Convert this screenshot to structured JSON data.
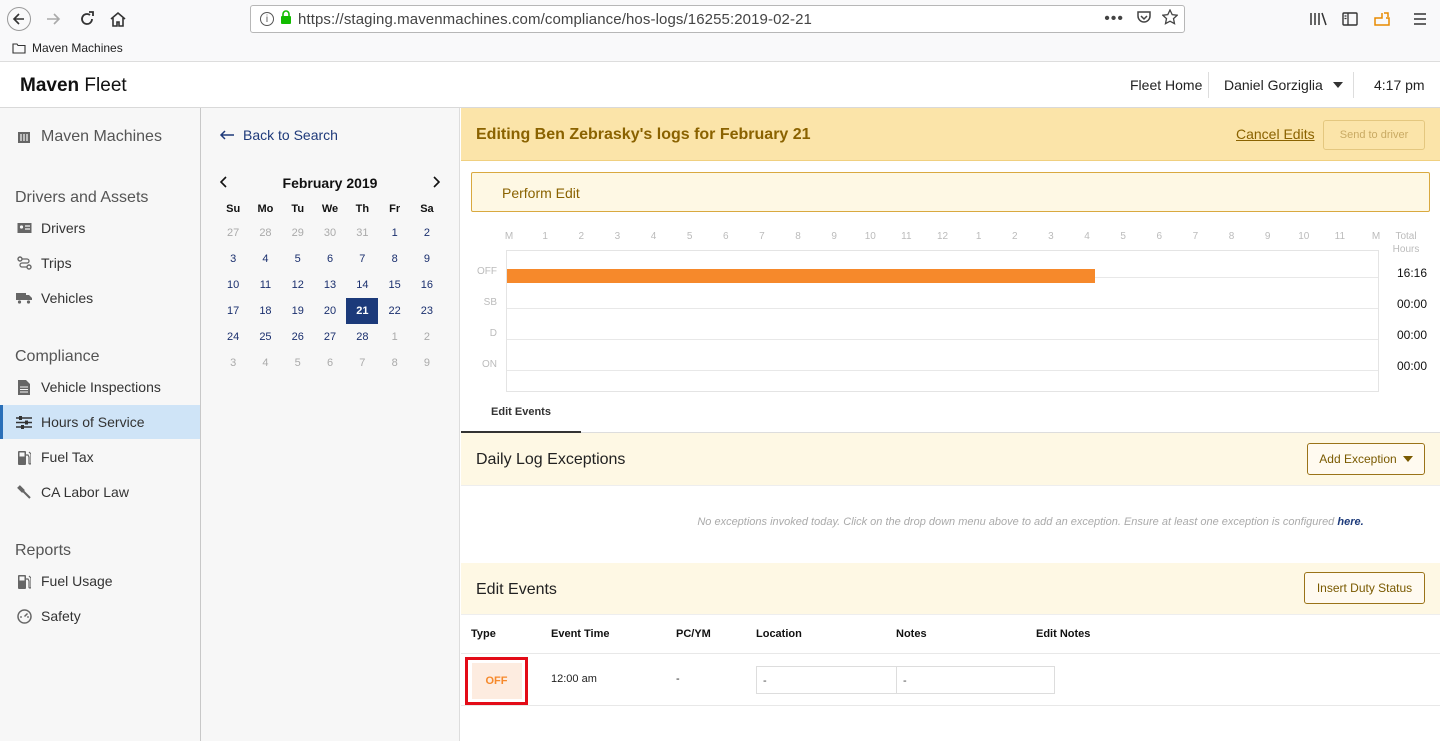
{
  "browser": {
    "url": "https://staging.mavenmachines.com/compliance/hos-logs/16255:2019-02-21",
    "bookmark": "Maven Machines"
  },
  "app": {
    "brand_bold": "Maven",
    "brand_rest": " Fleet",
    "fleet_home": "Fleet Home",
    "user": "Daniel Gorziglia",
    "time": "4:17 pm"
  },
  "sidebar": {
    "org": "Maven Machines",
    "sections": [
      {
        "title": "Drivers and Assets",
        "items": [
          "Drivers",
          "Trips",
          "Vehicles"
        ]
      },
      {
        "title": "Compliance",
        "items": [
          "Vehicle Inspections",
          "Hours of Service",
          "Fuel Tax",
          "CA Labor Law"
        ]
      },
      {
        "title": "Reports",
        "items": [
          "Fuel Usage",
          "Safety"
        ]
      }
    ],
    "active_item": "Hours of Service"
  },
  "calendar": {
    "back_label": "Back to Search",
    "month_label": "February 2019",
    "dow": [
      "Su",
      "Mo",
      "Tu",
      "We",
      "Th",
      "Fr",
      "Sa"
    ],
    "days": [
      "27",
      "28",
      "29",
      "30",
      "31",
      "1",
      "2",
      "3",
      "4",
      "5",
      "6",
      "7",
      "8",
      "9",
      "10",
      "11",
      "12",
      "13",
      "14",
      "15",
      "16",
      "17",
      "18",
      "19",
      "20",
      "21",
      "22",
      "23",
      "24",
      "25",
      "26",
      "27",
      "28",
      "1",
      "2",
      "3",
      "4",
      "5",
      "6",
      "7",
      "8",
      "9"
    ],
    "muted_indices": [
      0,
      1,
      2,
      3,
      4,
      33,
      34,
      35,
      36,
      37,
      38,
      39,
      40,
      41
    ],
    "selected_index": 25
  },
  "editor": {
    "title": "Editing Ben Zebrasky's logs for February 21",
    "cancel_label": "Cancel Edits",
    "send_label": "Send to driver",
    "perform_label": "Perform Edit"
  },
  "log_chart": {
    "hour_labels": [
      "M",
      "1",
      "2",
      "3",
      "4",
      "5",
      "6",
      "7",
      "8",
      "9",
      "10",
      "11",
      "12",
      "1",
      "2",
      "3",
      "4",
      "5",
      "6",
      "7",
      "8",
      "9",
      "10",
      "11",
      "M"
    ],
    "total_label_1": "Total",
    "total_label_2": "Hours",
    "rows": [
      {
        "status": "OFF",
        "total": "16:16"
      },
      {
        "status": "SB",
        "total": "00:00"
      },
      {
        "status": "D",
        "total": "00:00"
      },
      {
        "status": "ON",
        "total": "00:00"
      }
    ],
    "segments": [
      {
        "status": "OFF",
        "start_hour": 0,
        "end_hour": 16.27
      }
    ],
    "bar_color": "#f6892b"
  },
  "tabs": {
    "edit_events": "Edit Events"
  },
  "exceptions": {
    "title": "Daily Log Exceptions",
    "add_label": "Add Exception",
    "empty_text": "No exceptions invoked today. Click on the drop down menu above to add an exception. Ensure at least one exception is configured ",
    "here_link": "here."
  },
  "events": {
    "title": "Edit Events",
    "insert_label": "Insert Duty Status",
    "columns": [
      "Type",
      "Event Time",
      "PC/YM",
      "Location",
      "Notes",
      "Edit Notes"
    ],
    "rows": [
      {
        "type": "OFF",
        "time": "12:00 am",
        "pcym": "-",
        "location": "-",
        "notes": "-",
        "edit_notes": ""
      }
    ]
  }
}
